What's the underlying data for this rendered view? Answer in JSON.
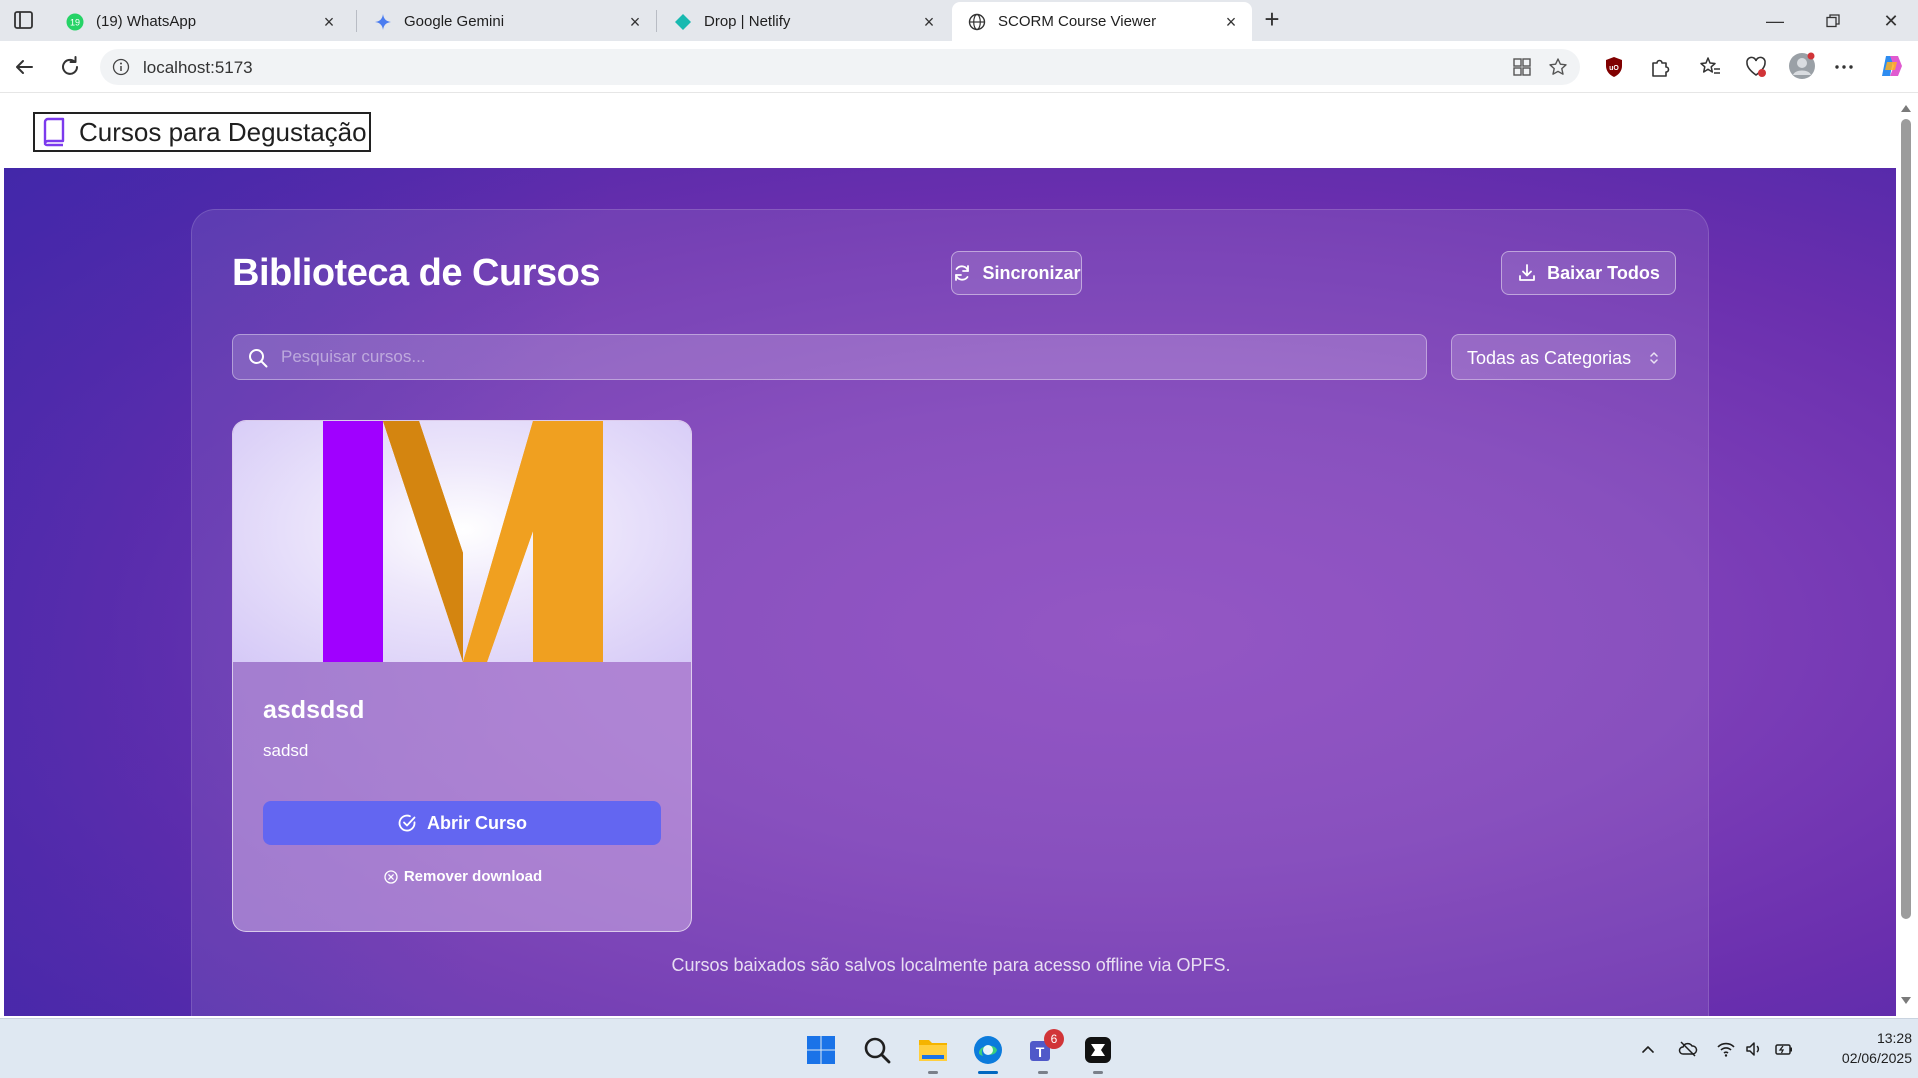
{
  "browser": {
    "tabs": [
      {
        "title": "(19) WhatsApp",
        "favicon": "whatsapp-icon",
        "badge": "19"
      },
      {
        "title": "Google Gemini",
        "favicon": "gemini-icon"
      },
      {
        "title": "Drop | Netlify",
        "favicon": "netlify-icon"
      },
      {
        "title": "SCORM Course Viewer",
        "favicon": "globe-icon",
        "active": true
      }
    ],
    "url": "localhost:5173"
  },
  "header": {
    "brand": "Cursos para Degustação",
    "brand_icon": "book-icon"
  },
  "library": {
    "title": "Biblioteca de Cursos",
    "sync_label": "Sincronizar",
    "download_all_label": "Baixar Todos",
    "search_placeholder": "Pesquisar cursos...",
    "category_selected": "Todas as Categorias",
    "courses": [
      {
        "title": "asdsdsd",
        "description": "sadsd",
        "open_label": "Abrir Curso",
        "remove_label": "Remover download"
      }
    ],
    "footer_note": "Cursos baixados são salvos localmente para acesso offline via OPFS."
  },
  "taskbar": {
    "teams_badge": "6",
    "time": "13:28",
    "date": "02/06/2025"
  },
  "colors": {
    "primary_button": "#6366f1",
    "gradient_start": "#4a27a8",
    "gradient_end": "#8a47bf",
    "logo_purple": "#a000ff",
    "logo_orange": "#f0a020",
    "logo_orange_dark": "#d48510"
  }
}
